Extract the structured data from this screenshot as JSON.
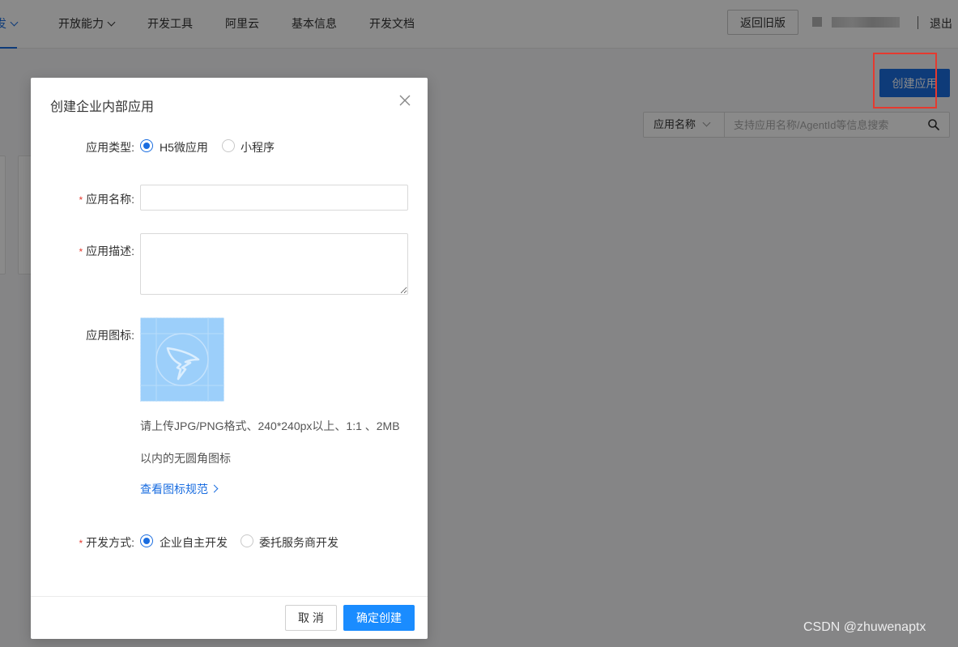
{
  "nav": {
    "items": [
      {
        "label": "发",
        "active": true
      },
      {
        "label": "开放能力"
      },
      {
        "label": "开发工具"
      },
      {
        "label": "阿里云"
      },
      {
        "label": "基本信息"
      },
      {
        "label": "开发文档"
      }
    ],
    "old_version_label": "返回旧版",
    "logout_label": "退出"
  },
  "page": {
    "create_app_label": "创建应用",
    "search": {
      "type_label": "应用名称",
      "placeholder": "支持应用名称/AgentId等信息搜索"
    }
  },
  "dialog": {
    "title": "创建企业内部应用",
    "app_type": {
      "label": "应用类型:",
      "options": [
        "H5微应用",
        "小程序"
      ],
      "selected": "H5微应用"
    },
    "app_name": {
      "label": "应用名称:",
      "required": true,
      "value": ""
    },
    "app_desc": {
      "label": "应用描述:",
      "required": true,
      "value": ""
    },
    "app_icon": {
      "label": "应用图标:",
      "hint_line1": "请上传JPG/PNG格式、240*240px以上、1:1 、2MB",
      "hint_line2": "以内的无圆角图标",
      "spec_link": "查看图标规范"
    },
    "dev_mode": {
      "label": "开发方式:",
      "required": true,
      "options": [
        "企业自主开发",
        "委托服务商开发"
      ],
      "selected": "企业自主开发"
    },
    "cancel_label": "取 消",
    "confirm_label": "确定创建"
  },
  "watermark": "CSDN @zhuwenaptx",
  "colors": {
    "primary": "#1a6de0",
    "confirm": "#1a8cff",
    "required": "#e53a2f",
    "highlight_box": "#e53a2f"
  }
}
